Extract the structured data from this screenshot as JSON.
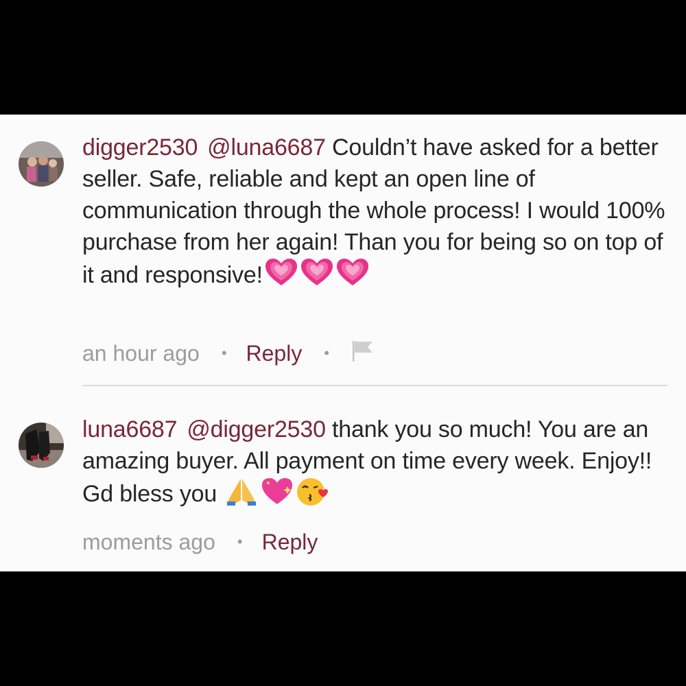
{
  "comments": [
    {
      "username": "digger2530",
      "mention": "@luna6687",
      "text": " Couldn’t have asked for a better seller. Safe, reliable and kept an open line of communication through the whole process! I would 100% purchase from her again! Than you for being so on top of it and responsive!",
      "emojis": [
        "growing-heart",
        "growing-heart",
        "growing-heart"
      ],
      "time": "an hour ago",
      "dot": "•",
      "reply_label": "Reply",
      "has_flag": true
    },
    {
      "username": "luna6687",
      "mention": "@digger2530",
      "text": " thank you so much! You are an amazing buyer. All payment on time every week. Enjoy!! Gd bless you ",
      "emojis": [
        "folded-hands",
        "sparkling-heart",
        "face-blowing-kiss"
      ],
      "time": "moments ago",
      "dot": "•",
      "reply_label": "Reply",
      "has_flag": false
    }
  ],
  "colors": {
    "username": "#7a2738",
    "body_text": "#262626",
    "meta_text": "#9c9c9c",
    "background": "#fbfbfb",
    "frame": "#000000"
  }
}
